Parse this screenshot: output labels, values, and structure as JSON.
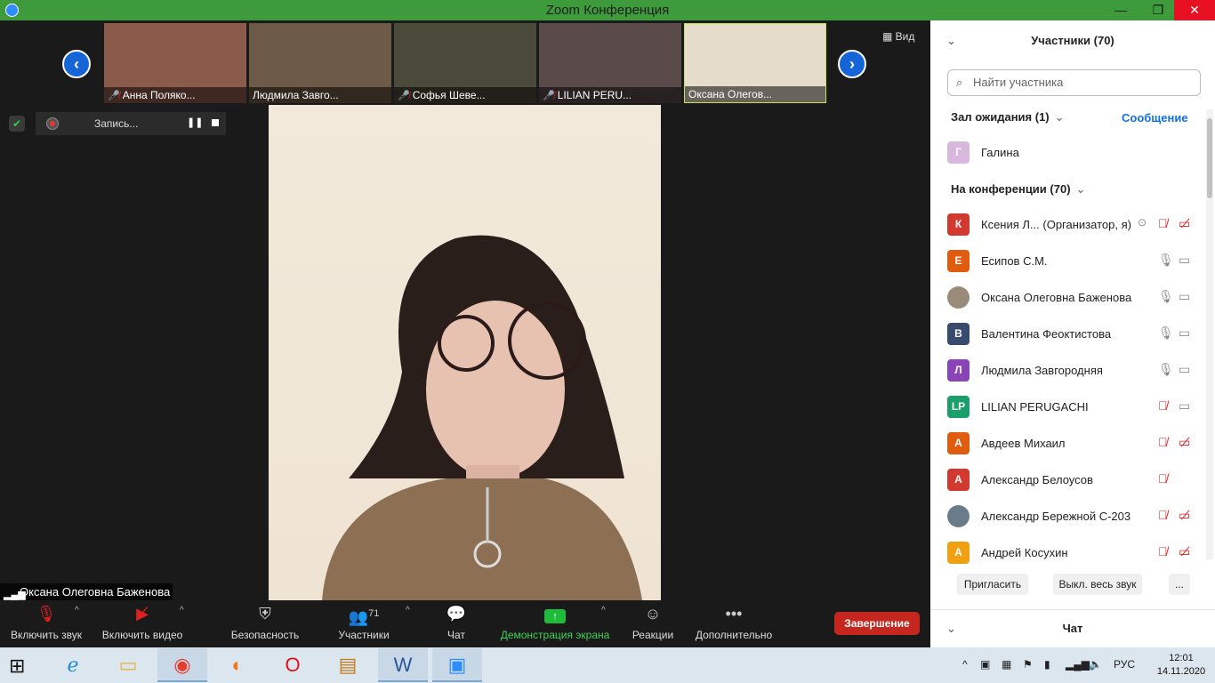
{
  "window": {
    "title": "Zoom Конференция",
    "minimize": "—",
    "maximize": "❐",
    "close": "✕"
  },
  "thumbnails": [
    {
      "name": "Анна Поляко...",
      "muted": true,
      "bg": "#8a5a4a"
    },
    {
      "name": "Людмила Завго...",
      "muted": false,
      "bg": "#6d5a48"
    },
    {
      "name": "Софья Шеве...",
      "muted": true,
      "bg": "#4a4a3a"
    },
    {
      "name": "LILIAN PERU...",
      "muted": true,
      "bg": "#5a4a4a"
    },
    {
      "name": "Оксана Олегов...",
      "muted": false,
      "bg": "#e6dcca"
    }
  ],
  "view_label": "Вид",
  "recording": {
    "label": "Запись...",
    "pause": "❚❚"
  },
  "speaker_name": "Оксана Олеговна Баженова",
  "toolbar": {
    "unmute": "Включить звук",
    "start_video": "Включить видео",
    "security": "Безопасность",
    "participants": "Участники",
    "participants_count": "71",
    "chat": "Чат",
    "share": "Демонстрация экрана",
    "reactions": "Реакции",
    "more": "Дополнительно",
    "end": "Завершение"
  },
  "panel": {
    "title": "Участники (70)",
    "search_placeholder": "Найти участника",
    "waiting_room": "Зал ожидания (1)",
    "message_link": "Сообщение",
    "waiting": [
      {
        "initial": "Г",
        "name": "Галина",
        "color": "#d9b8dd"
      }
    ],
    "in_meeting": "На конференции (70)",
    "participants": [
      {
        "initial": "К",
        "name": "Ксения Л...  (Организатор, я)",
        "color": "#d33a2f",
        "mic_off": true,
        "cam_off": true,
        "rec": true
      },
      {
        "initial": "Е",
        "name": "Есипов С.М.",
        "color": "#e05d10",
        "mic_off": false,
        "cam_off": false,
        "rec": false
      },
      {
        "initial": "",
        "name": "Оксана Олеговна Баженова",
        "color": "#9a8a7a",
        "mic_off": false,
        "cam_off": false,
        "rec": false
      },
      {
        "initial": "В",
        "name": "Валентина Феоктистова",
        "color": "#384a6e",
        "mic_off": false,
        "cam_off": false,
        "rec": false
      },
      {
        "initial": "Л",
        "name": "Людмила Завгородняя",
        "color": "#8a44b8",
        "mic_off": false,
        "cam_off": false,
        "rec": false
      },
      {
        "initial": "LP",
        "name": "LILIAN PERUGACHI",
        "color": "#1a9e6a",
        "mic_off": true,
        "cam_off": false,
        "rec": false
      },
      {
        "initial": "А",
        "name": "Авдеев Михаил",
        "color": "#e05d10",
        "mic_off": true,
        "cam_off": true,
        "rec": false
      },
      {
        "initial": "А",
        "name": "Александр Белоусов",
        "color": "#d33a2f",
        "mic_off": true,
        "cam_off": null,
        "rec": false
      },
      {
        "initial": "",
        "name": "Александр Бережной С-203",
        "color": "#6a7c8a",
        "mic_off": true,
        "cam_off": true,
        "rec": false
      },
      {
        "initial": "А",
        "name": "Андрей Косухин",
        "color": "#f0a010",
        "mic_off": true,
        "cam_off": true,
        "rec": false
      }
    ],
    "invite": "Пригласить",
    "mute_all": "Выкл. весь звук",
    "more": "...",
    "chat_title": "Чат"
  },
  "taskbar": {
    "language": "РУС",
    "time": "12:01",
    "date": "14.11.2020"
  }
}
